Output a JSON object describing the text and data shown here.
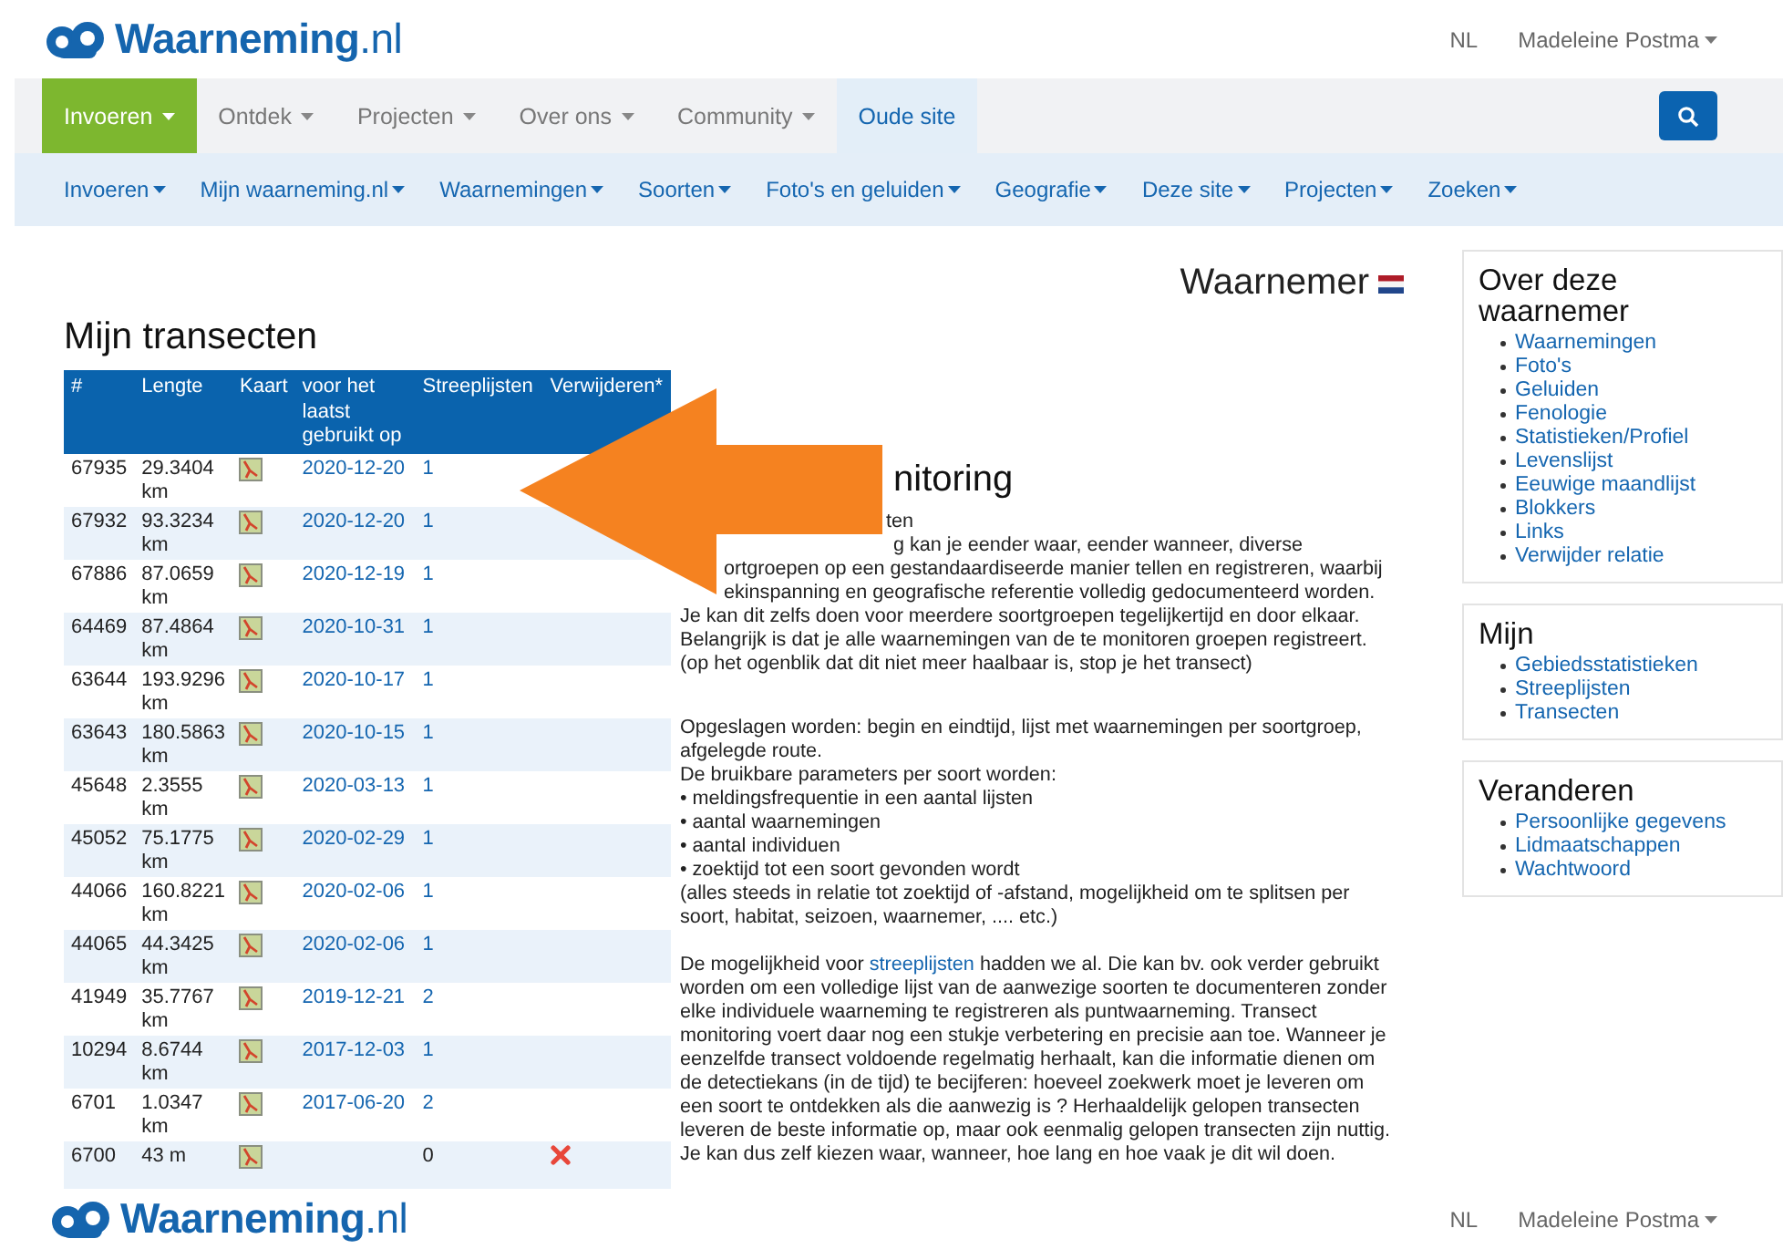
{
  "header": {
    "logo": {
      "name": "Waarneming",
      "suffix": ".nl"
    },
    "language": "NL",
    "user": "Madeleine Postma"
  },
  "main_nav": [
    {
      "label": "Invoeren",
      "kind": "dropdown",
      "selected": true
    },
    {
      "label": "Ontdek",
      "kind": "dropdown",
      "selected": false
    },
    {
      "label": "Projecten",
      "kind": "dropdown",
      "selected": false
    },
    {
      "label": "Over ons",
      "kind": "dropdown",
      "selected": false
    },
    {
      "label": "Community",
      "kind": "dropdown",
      "selected": false
    },
    {
      "label": "Oude site",
      "kind": "link",
      "selected": false
    }
  ],
  "sub_nav": [
    "Invoeren",
    "Mijn waarneming.nl",
    "Waarnemingen",
    "Soorten",
    "Foto's en geluiden",
    "Geografie",
    "Deze site",
    "Projecten",
    "Zoeken"
  ],
  "page_title": "Waarnemer",
  "transects": {
    "title": "Mijn transecten",
    "columns": [
      "#",
      "Lengte",
      "Kaart",
      "voor het laatst gebruikt op",
      "Streeplijsten",
      "Verwijderen*"
    ],
    "rows": [
      {
        "id": "67935",
        "length": "29.3404 km",
        "date": "2020-12-20",
        "count": "1",
        "count_link": true,
        "deletable": false
      },
      {
        "id": "67932",
        "length": "93.3234 km",
        "date": "2020-12-20",
        "count": "1",
        "count_link": true,
        "deletable": false
      },
      {
        "id": "67886",
        "length": "87.0659 km",
        "date": "2020-12-19",
        "count": "1",
        "count_link": true,
        "deletable": false
      },
      {
        "id": "64469",
        "length": "87.4864 km",
        "date": "2020-10-31",
        "count": "1",
        "count_link": true,
        "deletable": false
      },
      {
        "id": "63644",
        "length": "193.9296 km",
        "date": "2020-10-17",
        "count": "1",
        "count_link": true,
        "deletable": false
      },
      {
        "id": "63643",
        "length": "180.5863 km",
        "date": "2020-10-15",
        "count": "1",
        "count_link": true,
        "deletable": false
      },
      {
        "id": "45648",
        "length": "2.3555 km",
        "date": "2020-03-13",
        "count": "1",
        "count_link": true,
        "deletable": false
      },
      {
        "id": "45052",
        "length": "75.1775 km",
        "date": "2020-02-29",
        "count": "1",
        "count_link": true,
        "deletable": false
      },
      {
        "id": "44066",
        "length": "160.8221 km",
        "date": "2020-02-06",
        "count": "1",
        "count_link": true,
        "deletable": false
      },
      {
        "id": "44065",
        "length": "44.3425 km",
        "date": "2020-02-06",
        "count": "1",
        "count_link": true,
        "deletable": false
      },
      {
        "id": "41949",
        "length": "35.7767 km",
        "date": "2019-12-21",
        "count": "2",
        "count_link": true,
        "deletable": false
      },
      {
        "id": "10294",
        "length": "8.6744 km",
        "date": "2017-12-03",
        "count": "1",
        "count_link": true,
        "deletable": false
      },
      {
        "id": "6701",
        "length": "1.0347 km",
        "date": "2017-06-20",
        "count": "2",
        "count_link": true,
        "deletable": false
      },
      {
        "id": "6700",
        "length": "43 m",
        "count": "0",
        "count_link": false,
        "deletable": true
      }
    ]
  },
  "article": {
    "heading": "nitoring",
    "subheading": "ten",
    "intro_lines": [
      "g kan je eender waar, eender wanneer, diverse",
      "ortgroepen op een gestandaardiseerde manier tellen en registreren, waarbij",
      "ekinspanning en geografische referentie volledig gedocumenteerd worden.",
      "Je kan dit zelfs doen voor meerdere soortgroepen tegelijkertijd en door elkaar.",
      "Belangrijk is dat je alle waarnemingen van de te monitoren groepen registreert.",
      "(op het ogenblik dat dit niet meer haalbaar is, stop je het transect)"
    ],
    "stored": "Opgeslagen worden: begin en eindtijd, lijst met waarnemingen per soortgroep, afgelegde route.",
    "params_intro": "De bruikbare parameters per soort worden:",
    "bullets": [
      "• meldingsfrequentie in een aantal lijsten",
      "• aantal waarnemingen",
      "• aantal individuen",
      "• zoektijd tot een soort gevonden wordt"
    ],
    "params_note": "(alles steeds in relatie tot zoektijd of -afstand, mogelijkheid om te splitsen per soort, habitat, seizoen, waarnemer, .... etc.)",
    "closing": {
      "before": "De mogelijkheid voor",
      "link": "streeplijsten",
      "after": "hadden we al. Die kan bv. ook verder gebruikt worden om een volledige lijst van de aanwezige soorten te documenteren zonder elke individuele waarneming te registreren als puntwaarneming. Transect monitoring voert daar nog een stukje verbetering en precisie aan toe. Wanneer je eenzelfde transect voldoende regelmatig herhaalt, kan die informatie dienen om de detectiekans (in de tijd) te becijferen: hoeveel zoekwerk moet je leveren om een soort te ontdekken als die aanwezig is ? Herhaaldelijk gelopen transecten leveren de beste informatie op, maar ook eenmalig gelopen transecten zijn nuttig. Je kan dus zelf kiezen waar, wanneer, hoe lang en hoe vaak je dit wil doen."
    }
  },
  "sidebar": [
    {
      "title": "Over deze waarnemer",
      "links": [
        "Waarnemingen",
        "Foto's",
        "Geluiden",
        "Fenologie",
        "Statistieken/Profiel",
        "Levenslijst",
        "Eeuwige maandlijst",
        "Blokkers",
        "Links",
        "Verwijder relatie"
      ]
    },
    {
      "title": "Mijn",
      "links": [
        "Gebiedsstatistieken",
        "Streeplijsten",
        "Transecten"
      ]
    },
    {
      "title": "Veranderen",
      "links": [
        "Persoonlijke gegevens",
        "Lidmaatschappen",
        "Wachtwoord"
      ]
    }
  ],
  "footer_bar": {
    "logo": {
      "name": "Waarneming",
      "suffix": ".nl"
    },
    "language": "NL",
    "user": "Madeleine Postma"
  }
}
